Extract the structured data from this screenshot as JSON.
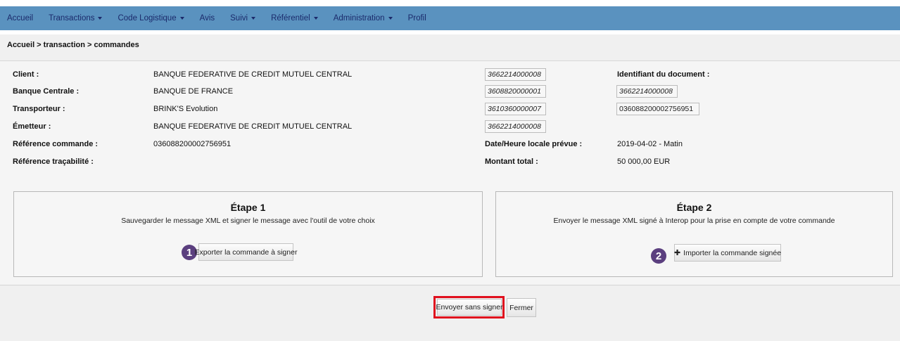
{
  "nav": {
    "items": [
      {
        "label": "Accueil",
        "dropdown": false
      },
      {
        "label": "Transactions",
        "dropdown": true
      },
      {
        "label": "Code Logistique",
        "dropdown": true
      },
      {
        "label": "Avis",
        "dropdown": false
      },
      {
        "label": "Suivi",
        "dropdown": true
      },
      {
        "label": "Référentiel",
        "dropdown": true
      },
      {
        "label": "Administration",
        "dropdown": true
      },
      {
        "label": "Profil",
        "dropdown": false
      }
    ]
  },
  "breadcrumb": "Accueil > transaction > commandes",
  "details": {
    "client_label": "Client :",
    "client_value": "BANQUE FEDERATIVE DE CREDIT MUTUEL CENTRAL",
    "client_code": "3662214000008",
    "banque_label": "Banque Centrale :",
    "banque_value": "BANQUE DE FRANCE",
    "banque_code": "3608820000001",
    "transporteur_label": "Transporteur :",
    "transporteur_value": "BRINK'S Evolution",
    "transporteur_code": "3610360000007",
    "emetteur_label": "Émetteur :",
    "emetteur_value": "BANQUE FEDERATIVE DE CREDIT MUTUEL CENTRAL",
    "emetteur_code": "3662214000008",
    "ref_commande_label": "Référence commande :",
    "ref_commande_value": "036088200002756951",
    "ref_tracabilite_label": "Référence traçabilité :",
    "identifiant_label": "Identifiant du document :",
    "identifiant_code1": "3662214000008",
    "identifiant_code2": "036088200002756951",
    "date_label": "Date/Heure locale prévue :",
    "date_value": "2019-04-02 - Matin",
    "montant_label": "Montant total :",
    "montant_value": "50 000,00  EUR"
  },
  "step1": {
    "title": "Étape 1",
    "desc": "Sauvegarder le message XML et signer le message avec l'outil de votre choix",
    "badge": "1",
    "button": "Exporter la commande à signer"
  },
  "step2": {
    "title": "Étape 2",
    "desc": "Envoyer le message XML signé à Interop pour la prise en compte de votre commande",
    "badge": "2",
    "button": "Importer la commande signée",
    "button_icon": "plus-icon"
  },
  "footer": {
    "send_label": "Envoyer sans signer",
    "close_label": "Fermer"
  },
  "colors": {
    "nav_bg": "#5a92bf",
    "nav_text": "#1b2a6b",
    "badge": "#5b3f7f",
    "highlight": "#e0101e"
  }
}
